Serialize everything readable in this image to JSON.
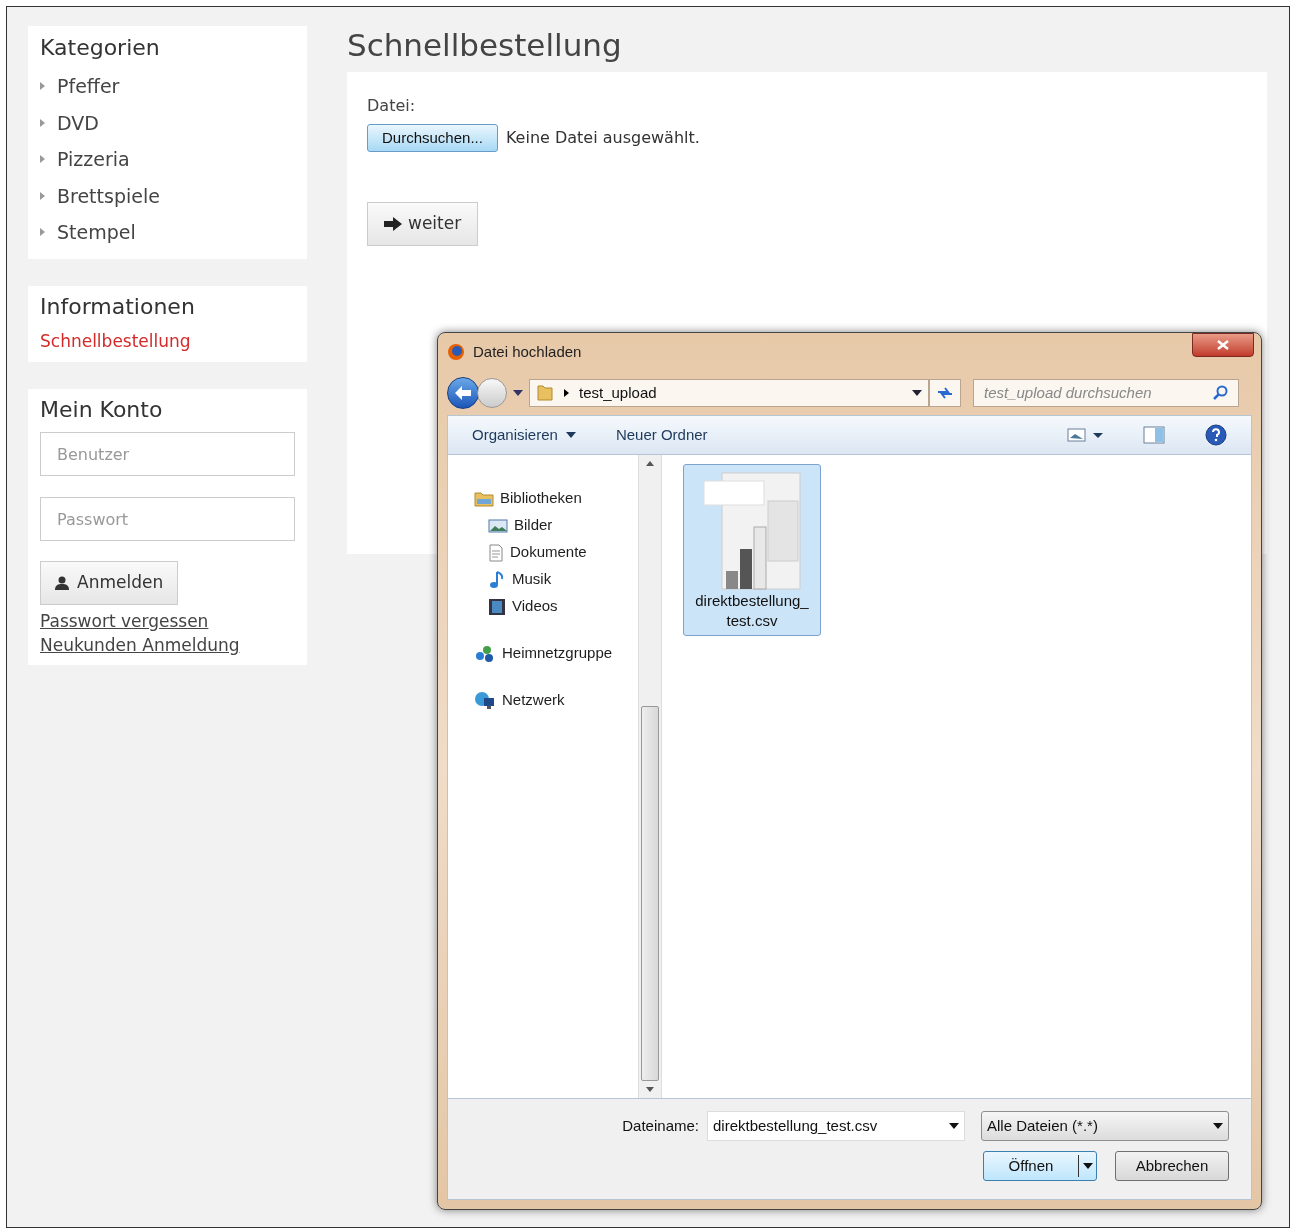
{
  "sidebar": {
    "categories": {
      "title": "Kategorien",
      "items": [
        "Pfeffer",
        "DVD",
        "Pizzeria",
        "Brettspiele",
        "Stempel"
      ]
    },
    "info": {
      "title": "Informationen",
      "links": [
        {
          "label": "Schnellbestellung",
          "selected": true
        }
      ]
    },
    "account": {
      "title": "Mein Konto",
      "user_placeholder": "Benutzer",
      "password_placeholder": "Passwort",
      "login_button": "Anmelden",
      "links": [
        "Passwort vergessen",
        "Neukunden Anmeldung"
      ]
    }
  },
  "main": {
    "title": "Schnellbestellung",
    "file_label": "Datei:",
    "browse_button": "Durchsuchen...",
    "no_file": "Keine Datei ausgewählt.",
    "next_button": "weiter"
  },
  "dialog": {
    "title": "Datei hochladen",
    "path": "test_upload",
    "search_placeholder": "test_upload durchsuchen",
    "toolbar": [
      "Organisieren",
      "Neuer Ordner"
    ],
    "nav": [
      {
        "label": "Bibliotheken",
        "kind": "library",
        "children": [
          {
            "label": "Bilder",
            "kind": "pictures"
          },
          {
            "label": "Dokumente",
            "kind": "documents"
          },
          {
            "label": "Musik",
            "kind": "music"
          },
          {
            "label": "Videos",
            "kind": "videos"
          }
        ]
      },
      {
        "label": "Heimnetzgruppe",
        "kind": "homegroup"
      },
      {
        "label": "Netzwerk",
        "kind": "network"
      }
    ],
    "files": [
      {
        "name": "direktbestellung_ test.csv",
        "selected": true
      }
    ],
    "filename_label": "Dateiname:",
    "filename": "direktbestellung_test.csv",
    "filter": "Alle Dateien (*.*)",
    "open_button": "Öffnen",
    "cancel_button": "Abbrechen"
  }
}
